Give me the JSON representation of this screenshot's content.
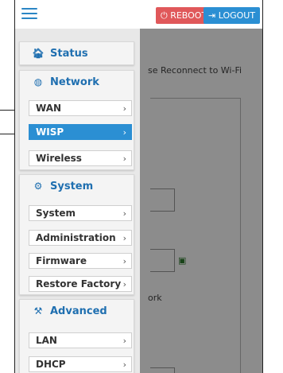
{
  "toolbar": {
    "reboot_label": "REBOOT",
    "logout_label": "LOGOUT",
    "reboot_icon": "power-icon",
    "logout_icon": "logout-icon",
    "reboot_color": "#e0585a",
    "logout_color": "#2b8fd3"
  },
  "background": {
    "notice_fragment": "se Reconnect to Wi-Fi",
    "network_fragment": "ork"
  },
  "sidebar": {
    "sections": [
      {
        "label": "Status",
        "icon": "home-icon"
      },
      {
        "label": "Network",
        "icon": "globe-icon"
      },
      {
        "label": "System",
        "icon": "gears-icon"
      },
      {
        "label": "Advanced",
        "icon": "tools-icon"
      }
    ],
    "network_items": [
      {
        "label": "WAN"
      },
      {
        "label": "WISP",
        "active": true
      },
      {
        "label": "Wireless"
      }
    ],
    "system_items": [
      {
        "label": "System"
      },
      {
        "label": "Administration"
      },
      {
        "label": "Firmware"
      },
      {
        "label": "Restore Factory"
      }
    ],
    "advanced_items": [
      {
        "label": "LAN"
      },
      {
        "label": "DHCP"
      }
    ],
    "accent_color": "#1f6fb0",
    "active_color": "#2b8fd3"
  }
}
